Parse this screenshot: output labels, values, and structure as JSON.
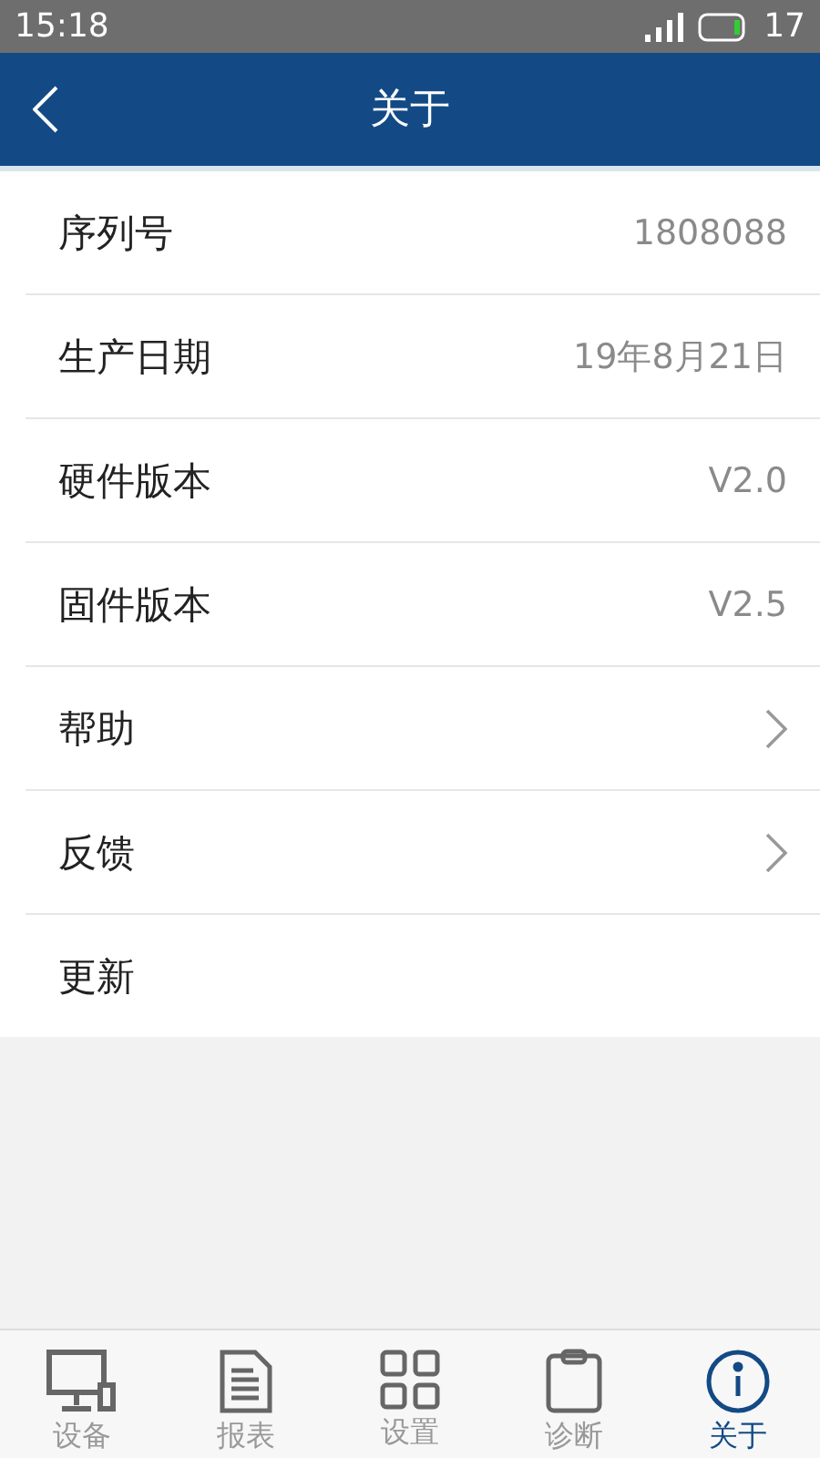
{
  "status_bar": {
    "time": "15:18",
    "battery_text": "17"
  },
  "header": {
    "title": "关于"
  },
  "rows": [
    {
      "label": "序列号",
      "kind": "value",
      "value": "1808088"
    },
    {
      "label": "生产日期",
      "kind": "value",
      "value": "19年8月21日"
    },
    {
      "label": "硬件版本",
      "kind": "value",
      "value": "V2.0"
    },
    {
      "label": "固件版本",
      "kind": "value",
      "value": "V2.5"
    },
    {
      "label": "帮助",
      "kind": "link"
    },
    {
      "label": "反馈",
      "kind": "link"
    },
    {
      "label": "更新",
      "kind": "plain"
    }
  ],
  "tabs": [
    {
      "label": "设备",
      "kind": "monitor",
      "selected": false
    },
    {
      "label": "报表",
      "kind": "document",
      "selected": false
    },
    {
      "label": "设置",
      "kind": "grid",
      "selected": false
    },
    {
      "label": "诊断",
      "kind": "clipboard",
      "selected": false
    },
    {
      "label": "关于",
      "kind": "info",
      "selected": true
    }
  ]
}
